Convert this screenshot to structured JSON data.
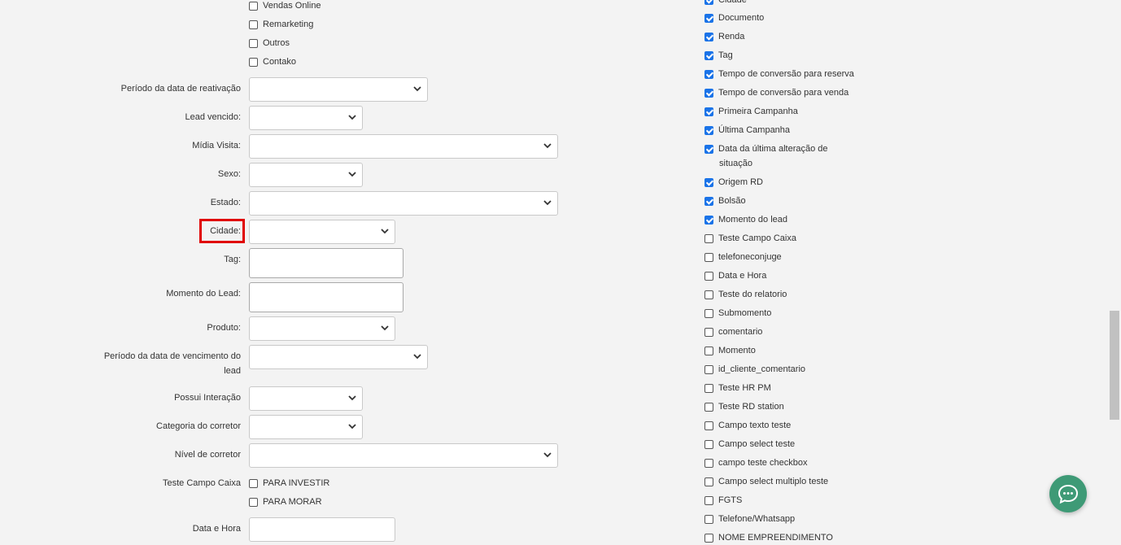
{
  "left_checkboxes": [
    {
      "label": "Vendas Online",
      "checked": false
    },
    {
      "label": "Remarketing",
      "checked": false
    },
    {
      "label": "Outros",
      "checked": false
    },
    {
      "label": "Contako",
      "checked": false
    }
  ],
  "fields": {
    "periodo_reativacao": "Período da data de reativação",
    "lead_vencido": "Lead vencido:",
    "midia_visita": "Mídia Visita:",
    "sexo": "Sexo:",
    "estado": "Estado:",
    "cidade": "Cidade:",
    "tag": "Tag:",
    "momento_lead": "Momento do Lead:",
    "produto": "Produto:",
    "periodo_vencimento_1": "Período da data de vencimento do",
    "periodo_vencimento_2": "lead",
    "possui_interacao": "Possui Interação",
    "categoria_corretor": "Categoria do corretor",
    "nivel_corretor": "Nível de corretor",
    "teste_campo_caixa": "Teste Campo Caixa",
    "data_hora": "Data e Hora"
  },
  "caixa_options": [
    {
      "label": "PARA INVESTIR",
      "checked": false
    },
    {
      "label": "PARA MORAR",
      "checked": false
    }
  ],
  "right_columns": [
    {
      "label": "Cidade",
      "checked": true
    },
    {
      "label": "Documento",
      "checked": true
    },
    {
      "label": "Renda",
      "checked": true
    },
    {
      "label": "Tag",
      "checked": true
    },
    {
      "label": "Tempo de conversão para reserva",
      "checked": true
    },
    {
      "label": "Tempo de conversão para venda",
      "checked": true
    },
    {
      "label": "Primeira Campanha",
      "checked": true
    },
    {
      "label": "Última Campanha",
      "checked": true
    },
    {
      "label": "Data da última alteração de",
      "label2": "situação",
      "checked": true
    },
    {
      "label": "Origem RD",
      "checked": true
    },
    {
      "label": "Bolsão",
      "checked": true
    },
    {
      "label": "Momento do lead",
      "checked": true
    },
    {
      "label": "Teste Campo Caixa",
      "checked": false
    },
    {
      "label": "telefoneconjuge",
      "checked": false
    },
    {
      "label": "Data e Hora",
      "checked": false
    },
    {
      "label": "Teste do relatorio",
      "checked": false
    },
    {
      "label": "Submomento",
      "checked": false
    },
    {
      "label": "comentario",
      "checked": false
    },
    {
      "label": "Momento",
      "checked": false
    },
    {
      "label": "id_cliente_comentario",
      "checked": false
    },
    {
      "label": "Teste HR PM",
      "checked": false
    },
    {
      "label": "Teste RD station",
      "checked": false
    },
    {
      "label": "Campo texto teste",
      "checked": false
    },
    {
      "label": "Campo select teste",
      "checked": false
    },
    {
      "label": "campo teste checkbox",
      "checked": false
    },
    {
      "label": "Campo select multiplo teste",
      "checked": false
    },
    {
      "label": "FGTS",
      "checked": false
    },
    {
      "label": "Telefone/Whatsapp",
      "checked": false
    },
    {
      "label": "NOME EMPREENDIMENTO",
      "checked": false
    }
  ],
  "colors": {
    "accent": "#1a73e8",
    "highlight": "#e00000",
    "chat": "#3e9a76"
  },
  "icons": {
    "select_arrow": "chevron-down-icon",
    "chat": "chat-bubble-icon"
  }
}
